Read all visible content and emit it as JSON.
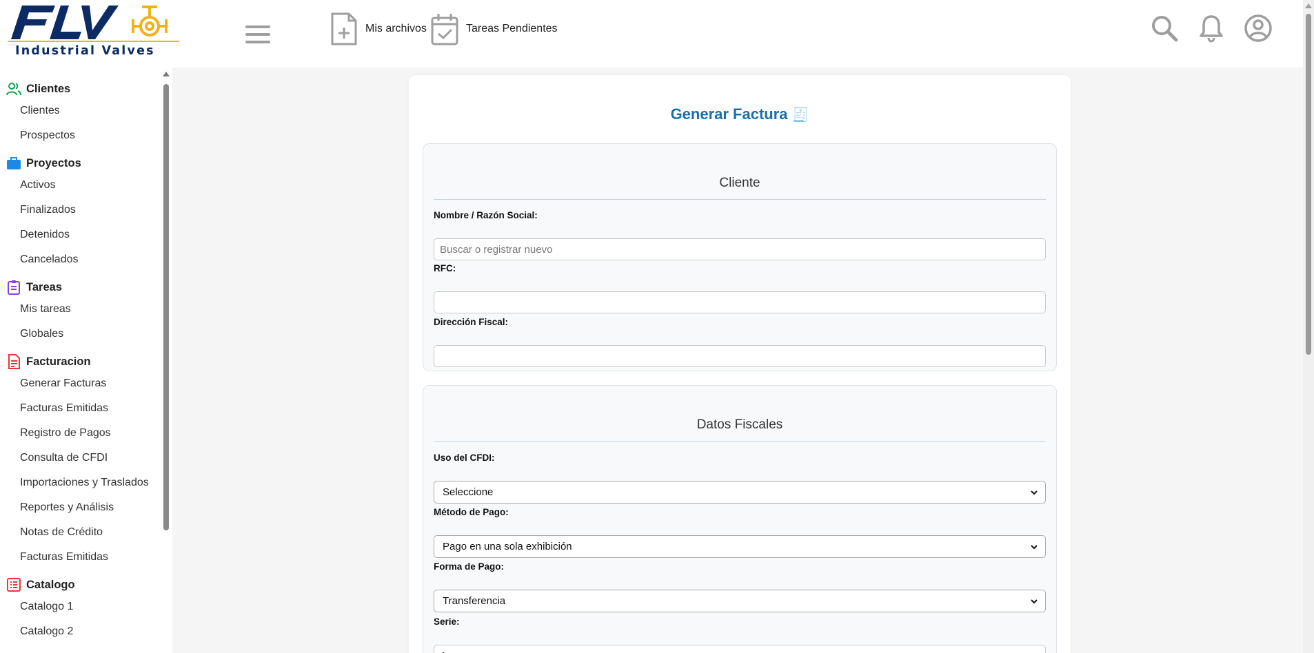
{
  "brand": {
    "logo_text": "Industrial Valves"
  },
  "header": {
    "links": [
      {
        "label": "Mis archivos",
        "icon": "file-plus-icon"
      },
      {
        "label": "Tareas Pendientes",
        "icon": "calendar-check-icon"
      }
    ],
    "icons": [
      "search-icon",
      "bell-icon",
      "user-circle-icon"
    ]
  },
  "sidebar": {
    "sections": [
      {
        "title": "Clientes",
        "icon": "users-icon",
        "color": "#16a34a",
        "items": [
          "Clientes",
          "Prospectos"
        ]
      },
      {
        "title": "Proyectos",
        "icon": "briefcase-icon",
        "color": "#1e88e5",
        "items": [
          "Activos",
          "Finalizados",
          "Detenidos",
          "Cancelados"
        ]
      },
      {
        "title": "Tareas",
        "icon": "clipboard-icon",
        "color": "#8b3fd9",
        "items": [
          "Mis tareas",
          "Globales"
        ]
      },
      {
        "title": "Facturacion",
        "icon": "invoice-icon",
        "color": "#e53935",
        "items": [
          "Generar Facturas",
          "Facturas Emitidas",
          "Registro de Pagos",
          "Consulta de CFDI",
          "Importaciones y Traslados",
          "Reportes y Análisis",
          "Notas de Crédito",
          "Facturas Emitidas"
        ]
      },
      {
        "title": "Catalogo",
        "icon": "list-icon",
        "color": "#e53935",
        "items": [
          "Catalogo 1",
          "Catalogo 2"
        ]
      }
    ]
  },
  "form": {
    "title": "Generar Factura",
    "title_emoji": "🧾",
    "cliente": {
      "legend": "Cliente",
      "nombre_label": "Nombre / Razón Social:",
      "nombre_placeholder": "Buscar o registrar nuevo",
      "nombre_value": "",
      "rfc_label": "RFC:",
      "rfc_value": "",
      "direccion_label": "Dirección Fiscal:",
      "direccion_value": ""
    },
    "fiscales": {
      "legend": "Datos Fiscales",
      "uso_label": "Uso del CFDI:",
      "uso_value": "Seleccione",
      "metodo_label": "Método de Pago:",
      "metodo_value": "Pago en una sola exhibición",
      "forma_label": "Forma de Pago:",
      "forma_value": "Transferencia",
      "serie_label": "Serie:",
      "serie_value": "A"
    }
  }
}
